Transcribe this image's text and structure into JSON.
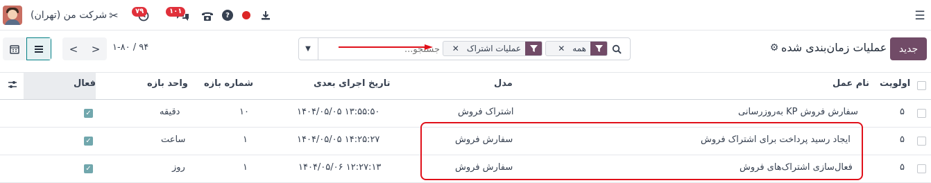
{
  "navbar": {
    "company": "شرکت من (تهران)",
    "activities_badge": "۷۹",
    "messages_badge": "۱۰۱",
    "menu_icon": "hamburger-icon",
    "icons": [
      "avatar",
      "tools-icon",
      "clock-icon",
      "chat-icon",
      "phone-icon",
      "help-icon",
      "record-icon",
      "download-icon"
    ]
  },
  "control": {
    "new_button": "جدید",
    "title": "عملیات زمان‌بندی شده",
    "search": {
      "placeholder": "جستجو...",
      "facets": [
        {
          "label": "همه",
          "icon": "filter-icon"
        },
        {
          "label": "عملیات اشتراک",
          "icon": "filter-icon"
        }
      ]
    },
    "pager": "۱-۸۰ / ۹۴"
  },
  "table": {
    "headers": {
      "priority": "اولویت",
      "name": "نام عمل",
      "model": "مدل",
      "nextcall": "تاریخ اجرای بعدی",
      "interval_number": "شماره بازه",
      "interval_type": "واحد بازه",
      "active": "فعال"
    },
    "rows": [
      {
        "priority": "۵",
        "name": "به‌روزرسانی KP سفارش فروش",
        "model": "اشتراک فروش",
        "nextcall": "۱۴۰۴/۰۵/۰۵ ۱۳:۵۵:۵۰",
        "interval_number": "۱۰",
        "interval_type": "دقیقه",
        "active": true
      },
      {
        "priority": "۵",
        "name": "ایجاد رسید پرداخت برای اشتراک فروش",
        "model": "سفارش فروش",
        "nextcall": "۱۴۰۴/۰۵/۰۵ ۱۴:۲۵:۲۷",
        "interval_number": "۱",
        "interval_type": "ساعت",
        "active": true
      },
      {
        "priority": "۵",
        "name": "فعال‌سازی اشتراک‌های فروش",
        "model": "سفارش فروش",
        "nextcall": "۱۴۰۴/۰۵/۰۶ ۱۲:۲۷:۱۳",
        "interval_number": "۱",
        "interval_type": "روز",
        "active": true
      }
    ]
  },
  "colors": {
    "brand": "#714b67",
    "badge": "#e0313b",
    "highlight": "#e0101a",
    "checkbox_active": "#71a7ad"
  }
}
